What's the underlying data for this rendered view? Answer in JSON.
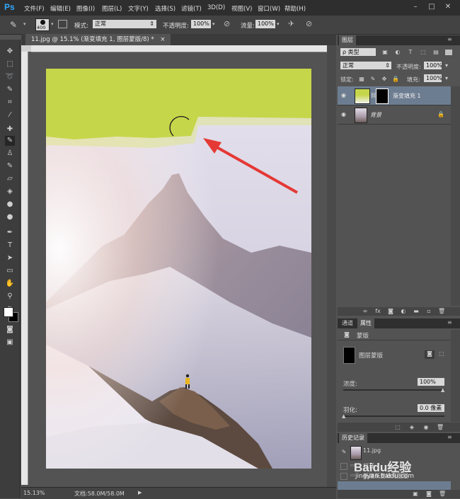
{
  "app": {
    "logo": "Ps"
  },
  "menu": [
    "文件(F)",
    "编辑(E)",
    "图像(I)",
    "图层(L)",
    "文字(Y)",
    "选择(S)",
    "滤镜(T)",
    "3D(D)",
    "视图(V)",
    "窗口(W)",
    "帮助(H)"
  ],
  "window_controls": [
    "–",
    "□",
    "✕"
  ],
  "options": {
    "brush_size": "400",
    "mode_label": "模式:",
    "mode_value": "正常",
    "opacity_label": "不透明度:",
    "opacity_value": "100%",
    "flow_label": "流量:",
    "flow_value": "100%"
  },
  "document": {
    "tab_title": "11.jpg @ 15.1% (渐变填充 1, 图层蒙版/8) *",
    "tab_close": "×",
    "overlay_color": "#c6d64a",
    "arrow_color": "#e53935"
  },
  "status": {
    "zoom": "15.13%",
    "doc_info": "文档:58.0M/58.0M"
  },
  "layers_panel": {
    "tab": "图层",
    "filter_label": "ρ 类型",
    "blend_mode": "正常",
    "opacity_label": "不透明度:",
    "opacity_value": "100%",
    "lock_label": "锁定:",
    "fill_label": "填充:",
    "fill_value": "100%",
    "layers": [
      {
        "name": "渐变填充 1",
        "selected": true
      },
      {
        "name": "背景",
        "selected": false
      }
    ]
  },
  "properties_panel": {
    "tabs": [
      "通道",
      "属性"
    ],
    "title": "蒙版",
    "mask_label": "图层蒙版",
    "density_label": "浓度:",
    "density_value": "100%",
    "feather_label": "羽化:",
    "feather_value": "0.0 像素"
  },
  "history_panel": {
    "tab": "历史记录",
    "snapshot": "11.jpg",
    "items": [
      "打开",
      "新建渐变填充图层"
    ]
  },
  "watermark": {
    "logo": "Baidu经验",
    "url": "jingyan.baidu.com"
  }
}
